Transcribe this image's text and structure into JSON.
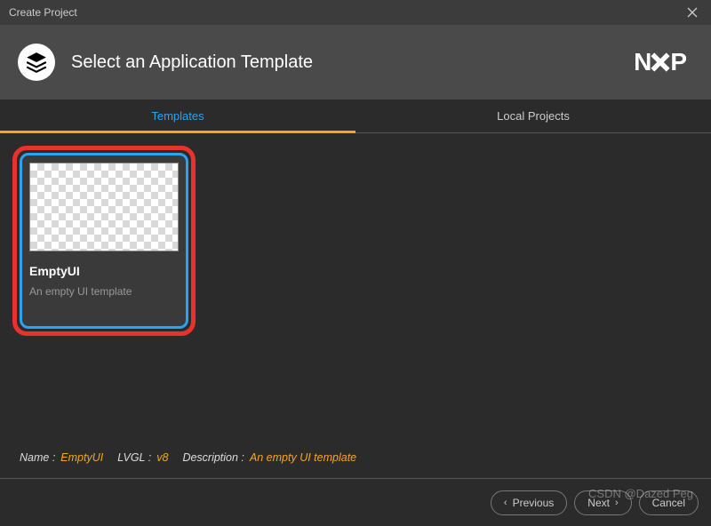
{
  "window": {
    "title": "Create Project"
  },
  "header": {
    "title": "Select an Application Template",
    "logo": "NXP"
  },
  "tabs": [
    {
      "label": "Templates",
      "active": true
    },
    {
      "label": "Local Projects",
      "active": false
    }
  ],
  "templates": [
    {
      "name": "EmptyUI",
      "description": "An empty UI template",
      "selected": true,
      "highlighted": true
    }
  ],
  "footer_info": {
    "name_label": "Name :",
    "name_value": "EmptyUI",
    "lvgl_label": "LVGL :",
    "lvgl_value": "v8",
    "description_label": "Description :",
    "description_value": "An empty UI template"
  },
  "buttons": {
    "previous": "Previous",
    "next": "Next",
    "cancel": "Cancel"
  },
  "watermark": "CSDN @Dazed Peg"
}
